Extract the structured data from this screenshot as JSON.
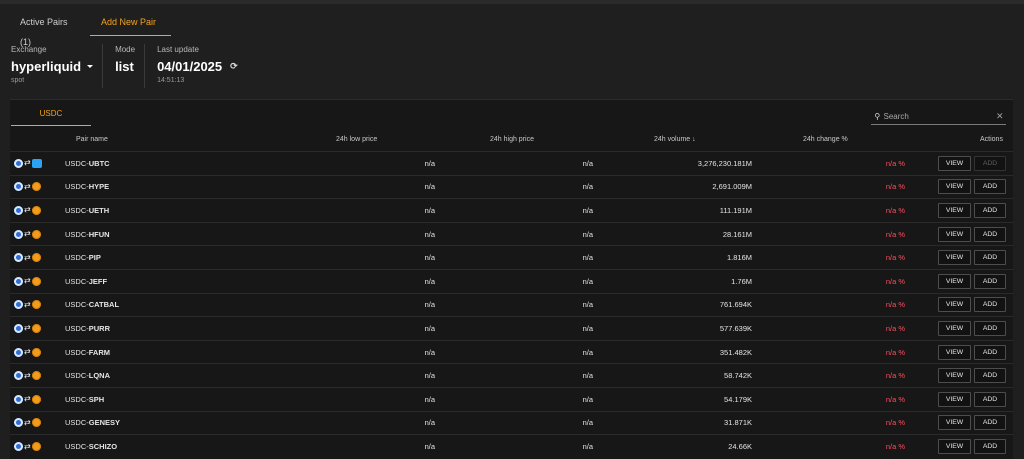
{
  "tabs": [
    {
      "label": "Active Pairs (1)",
      "active": false
    },
    {
      "label": "Add New Pair",
      "active": true
    }
  ],
  "info": {
    "exchange_label": "Exchange",
    "exchange_value": "hyperliquid",
    "exchange_sub": "spot",
    "mode_label": "Mode",
    "mode_value": "list",
    "update_label": "Last update",
    "update_value": "04/01/2025",
    "update_time": "14:51:13"
  },
  "panel": {
    "quote_tab": "USDC",
    "search_placeholder": "Search"
  },
  "columns": {
    "pair": "Pair name",
    "low": "24h low price",
    "high": "24h high price",
    "volume": "24h volume ↓",
    "change": "24h change %",
    "actions": "Actions"
  },
  "buttons": {
    "view": "VIEW",
    "add": "ADD"
  },
  "colors": {
    "accent": "#f5a31a",
    "negative": "#ff4d5e"
  },
  "rows": [
    {
      "quote": "USDC-",
      "base": "UBTC",
      "low": "n/a",
      "high": "n/a",
      "volume": "3,276,230.181M",
      "change": "n/a %",
      "add_disabled": true,
      "base_icon": "ubtc-icon"
    },
    {
      "quote": "USDC-",
      "base": "HYPE",
      "low": "n/a",
      "high": "n/a",
      "volume": "2,691.009M",
      "change": "n/a %",
      "add_disabled": false,
      "base_icon": "hype-icon"
    },
    {
      "quote": "USDC-",
      "base": "UETH",
      "low": "n/a",
      "high": "n/a",
      "volume": "111.191M",
      "change": "n/a %",
      "add_disabled": false,
      "base_icon": "hype-icon"
    },
    {
      "quote": "USDC-",
      "base": "HFUN",
      "low": "n/a",
      "high": "n/a",
      "volume": "28.161M",
      "change": "n/a %",
      "add_disabled": false,
      "base_icon": "hype-icon"
    },
    {
      "quote": "USDC-",
      "base": "PIP",
      "low": "n/a",
      "high": "n/a",
      "volume": "1.816M",
      "change": "n/a %",
      "add_disabled": false,
      "base_icon": "hype-icon"
    },
    {
      "quote": "USDC-",
      "base": "JEFF",
      "low": "n/a",
      "high": "n/a",
      "volume": "1.76M",
      "change": "n/a %",
      "add_disabled": false,
      "base_icon": "hype-icon"
    },
    {
      "quote": "USDC-",
      "base": "CATBAL",
      "low": "n/a",
      "high": "n/a",
      "volume": "761.694K",
      "change": "n/a %",
      "add_disabled": false,
      "base_icon": "hype-icon"
    },
    {
      "quote": "USDC-",
      "base": "PURR",
      "low": "n/a",
      "high": "n/a",
      "volume": "577.639K",
      "change": "n/a %",
      "add_disabled": false,
      "base_icon": "hype-icon"
    },
    {
      "quote": "USDC-",
      "base": "FARM",
      "low": "n/a",
      "high": "n/a",
      "volume": "351.482K",
      "change": "n/a %",
      "add_disabled": false,
      "base_icon": "hype-icon"
    },
    {
      "quote": "USDC-",
      "base": "LQNA",
      "low": "n/a",
      "high": "n/a",
      "volume": "58.742K",
      "change": "n/a %",
      "add_disabled": false,
      "base_icon": "hype-icon"
    },
    {
      "quote": "USDC-",
      "base": "SPH",
      "low": "n/a",
      "high": "n/a",
      "volume": "54.179K",
      "change": "n/a %",
      "add_disabled": false,
      "base_icon": "hype-icon"
    },
    {
      "quote": "USDC-",
      "base": "GENESY",
      "low": "n/a",
      "high": "n/a",
      "volume": "31.871K",
      "change": "n/a %",
      "add_disabled": false,
      "base_icon": "hype-icon"
    },
    {
      "quote": "USDC-",
      "base": "SCHIZO",
      "low": "n/a",
      "high": "n/a",
      "volume": "24.66K",
      "change": "n/a %",
      "add_disabled": false,
      "base_icon": "hype-icon"
    }
  ]
}
